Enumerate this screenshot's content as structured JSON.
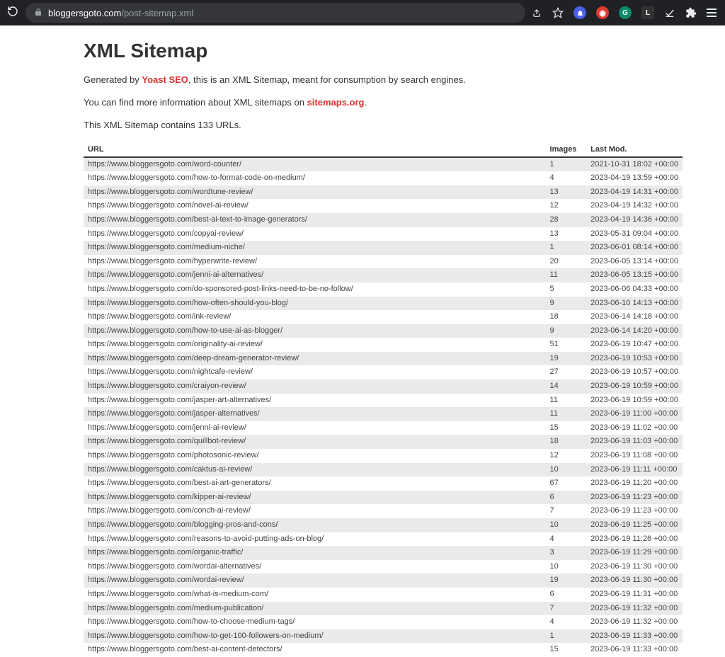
{
  "browser": {
    "url_domain": "bloggersgoto.com",
    "url_path": "/post-sitemap.xml"
  },
  "page": {
    "title": "XML Sitemap",
    "intro_prefix": "Generated by ",
    "yoast_text": "Yoast SEO",
    "intro_suffix": ", this is an XML Sitemap, meant for consumption by search engines.",
    "info_prefix": "You can find more information about XML sitemaps on ",
    "sitemaps_text": "sitemaps.org",
    "info_suffix": ".",
    "count_text": "This XML Sitemap contains 133 URLs."
  },
  "headers": {
    "url": "URL",
    "images": "Images",
    "lastmod": "Last Mod."
  },
  "rows": [
    {
      "url": "https://www.bloggersgoto.com/word-counter/",
      "images": "1",
      "lastmod": "2021-10-31 18:02 +00:00"
    },
    {
      "url": "https://www.bloggersgoto.com/how-to-format-code-on-medium/",
      "images": "4",
      "lastmod": "2023-04-19 13:59 +00:00"
    },
    {
      "url": "https://www.bloggersgoto.com/wordtune-review/",
      "images": "13",
      "lastmod": "2023-04-19 14:31 +00:00"
    },
    {
      "url": "https://www.bloggersgoto.com/novel-ai-review/",
      "images": "12",
      "lastmod": "2023-04-19 14:32 +00:00"
    },
    {
      "url": "https://www.bloggersgoto.com/best-ai-text-to-image-generators/",
      "images": "28",
      "lastmod": "2023-04-19 14:36 +00:00"
    },
    {
      "url": "https://www.bloggersgoto.com/copyai-review/",
      "images": "13",
      "lastmod": "2023-05-31 09:04 +00:00"
    },
    {
      "url": "https://www.bloggersgoto.com/medium-niche/",
      "images": "1",
      "lastmod": "2023-06-01 08:14 +00:00"
    },
    {
      "url": "https://www.bloggersgoto.com/hyperwrite-review/",
      "images": "20",
      "lastmod": "2023-06-05 13:14 +00:00"
    },
    {
      "url": "https://www.bloggersgoto.com/jenni-ai-alternatives/",
      "images": "11",
      "lastmod": "2023-06-05 13:15 +00:00"
    },
    {
      "url": "https://www.bloggersgoto.com/do-sponsored-post-links-need-to-be-no-follow/",
      "images": "5",
      "lastmod": "2023-06-06 04:33 +00:00"
    },
    {
      "url": "https://www.bloggersgoto.com/how-often-should-you-blog/",
      "images": "9",
      "lastmod": "2023-06-10 14:13 +00:00"
    },
    {
      "url": "https://www.bloggersgoto.com/ink-review/",
      "images": "18",
      "lastmod": "2023-06-14 14:18 +00:00"
    },
    {
      "url": "https://www.bloggersgoto.com/how-to-use-ai-as-blogger/",
      "images": "9",
      "lastmod": "2023-06-14 14:20 +00:00"
    },
    {
      "url": "https://www.bloggersgoto.com/originality-ai-review/",
      "images": "51",
      "lastmod": "2023-06-19 10:47 +00:00"
    },
    {
      "url": "https://www.bloggersgoto.com/deep-dream-generator-review/",
      "images": "19",
      "lastmod": "2023-06-19 10:53 +00:00"
    },
    {
      "url": "https://www.bloggersgoto.com/nightcafe-review/",
      "images": "27",
      "lastmod": "2023-06-19 10:57 +00:00"
    },
    {
      "url": "https://www.bloggersgoto.com/craiyon-review/",
      "images": "14",
      "lastmod": "2023-06-19 10:59 +00:00"
    },
    {
      "url": "https://www.bloggersgoto.com/jasper-art-alternatives/",
      "images": "11",
      "lastmod": "2023-06-19 10:59 +00:00"
    },
    {
      "url": "https://www.bloggersgoto.com/jasper-alternatives/",
      "images": "11",
      "lastmod": "2023-06-19 11:00 +00:00"
    },
    {
      "url": "https://www.bloggersgoto.com/jenni-ai-review/",
      "images": "15",
      "lastmod": "2023-06-19 11:02 +00:00"
    },
    {
      "url": "https://www.bloggersgoto.com/quillbot-review/",
      "images": "18",
      "lastmod": "2023-06-19 11:03 +00:00"
    },
    {
      "url": "https://www.bloggersgoto.com/photosonic-review/",
      "images": "12",
      "lastmod": "2023-06-19 11:08 +00:00"
    },
    {
      "url": "https://www.bloggersgoto.com/caktus-ai-review/",
      "images": "10",
      "lastmod": "2023-06-19 11:11 +00:00"
    },
    {
      "url": "https://www.bloggersgoto.com/best-ai-art-generators/",
      "images": "67",
      "lastmod": "2023-06-19 11:20 +00:00"
    },
    {
      "url": "https://www.bloggersgoto.com/kipper-ai-review/",
      "images": "6",
      "lastmod": "2023-06-19 11:23 +00:00"
    },
    {
      "url": "https://www.bloggersgoto.com/conch-ai-review/",
      "images": "7",
      "lastmod": "2023-06-19 11:23 +00:00"
    },
    {
      "url": "https://www.bloggersgoto.com/blogging-pros-and-cons/",
      "images": "10",
      "lastmod": "2023-06-19 11:25 +00:00"
    },
    {
      "url": "https://www.bloggersgoto.com/reasons-to-avoid-putting-ads-on-blog/",
      "images": "4",
      "lastmod": "2023-06-19 11:26 +00:00"
    },
    {
      "url": "https://www.bloggersgoto.com/organic-traffic/",
      "images": "3",
      "lastmod": "2023-06-19 11:29 +00:00"
    },
    {
      "url": "https://www.bloggersgoto.com/wordai-alternatives/",
      "images": "10",
      "lastmod": "2023-06-19 11:30 +00:00"
    },
    {
      "url": "https://www.bloggersgoto.com/wordai-review/",
      "images": "19",
      "lastmod": "2023-06-19 11:30 +00:00"
    },
    {
      "url": "https://www.bloggersgoto.com/what-is-medium-com/",
      "images": "6",
      "lastmod": "2023-06-19 11:31 +00:00"
    },
    {
      "url": "https://www.bloggersgoto.com/medium-publication/",
      "images": "7",
      "lastmod": "2023-06-19 11:32 +00:00"
    },
    {
      "url": "https://www.bloggersgoto.com/how-to-choose-medium-tags/",
      "images": "4",
      "lastmod": "2023-06-19 11:32 +00:00"
    },
    {
      "url": "https://www.bloggersgoto.com/how-to-get-100-followers-on-medium/",
      "images": "1",
      "lastmod": "2023-06-19 11:33 +00:00"
    },
    {
      "url": "https://www.bloggersgoto.com/best-ai-content-detectors/",
      "images": "15",
      "lastmod": "2023-06-19 11:33 +00:00"
    }
  ]
}
